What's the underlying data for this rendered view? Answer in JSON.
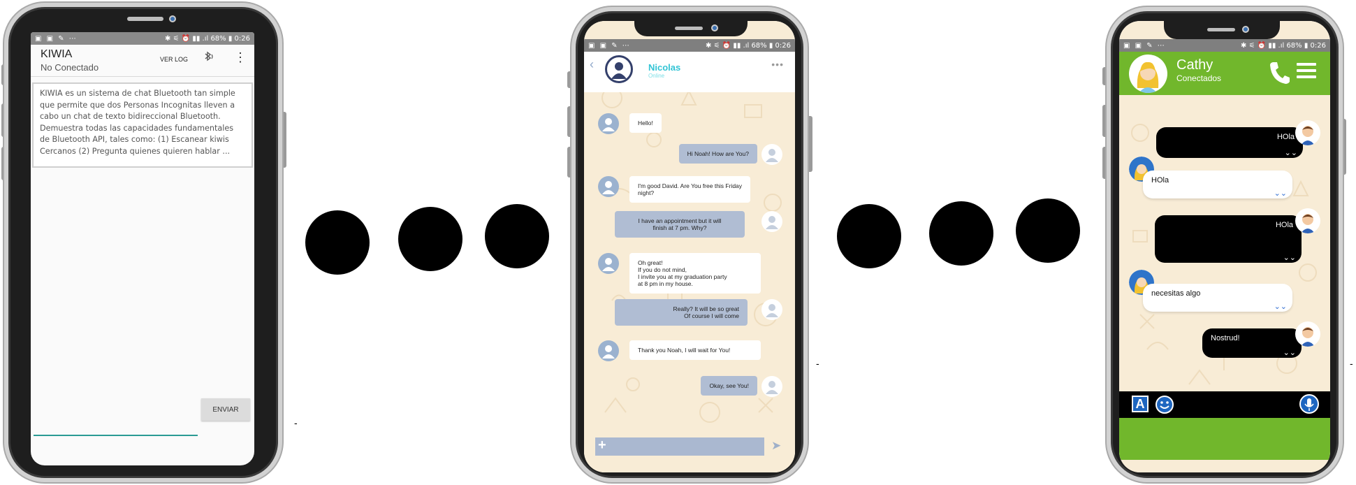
{
  "phone1": {
    "status_bar": {
      "left_icons": "▣ ▣ ✎ ⋯",
      "right": "✱ ⚟ ⏰ ▮▮ .ıl 68% ▮ 0:26"
    },
    "app_title": "KIWIA",
    "connection_status": "No Conectado",
    "ver_log": "VER LOG",
    "description": "KIWIA es un sistema de chat Bluetooth tan simple que permite que dos Personas Incognitas lleven a cabo un chat de texto bidireccional Bluetooth. Demuestra todas las capacidades fundamentales de Bluetooth API, tales como: (1) Escanear kiwis Cercanos (2) Pregunta quienes quieren hablar ...",
    "send_label": "ENVIAR",
    "input_value": ""
  },
  "phone2": {
    "status_bar": {
      "left_icons": "▣ ▣ ✎ ⋯",
      "right": "✱ ⚟ ⏰ ▮▮ .ıl 68% ▮ 0:26"
    },
    "contact_name": "Nicolas",
    "contact_status": "Online",
    "messages": [
      {
        "dir": "in",
        "text": "Hello!"
      },
      {
        "dir": "out",
        "text": "Hi Noah! How are You?"
      },
      {
        "dir": "in",
        "text": "I'm good David. Are You free this Friday\nnight?"
      },
      {
        "dir": "out",
        "text": "I have an appointment but it will\nfinish at 7 pm. Why?"
      },
      {
        "dir": "in",
        "text": "Oh great!\nIf you do not mind,\nI invite you at my graduation party\nat 8 pm in my house."
      },
      {
        "dir": "out",
        "text": "Really? It will be so great\nOf course I will come"
      },
      {
        "dir": "in",
        "text": "Thank you Noah, I will wait for You!"
      },
      {
        "dir": "out",
        "text": "Okay, see You!"
      }
    ],
    "composer_value": ""
  },
  "phone3": {
    "status_bar": {
      "left_icons": "▣ ▣ ✎ ⋯",
      "right": "✱ ⚟ ⏰ ▮▮ .ıl 68% ▮ 0:26"
    },
    "contact_name": "Cathy",
    "contact_status": "Conectados",
    "messages": [
      {
        "side": "sent",
        "text": "HOla"
      },
      {
        "side": "received",
        "text": "HOla"
      },
      {
        "side": "sent",
        "text": "HOla"
      },
      {
        "side": "received",
        "text": "necesitas algo"
      },
      {
        "side": "sent",
        "text": "Nostrud!"
      }
    ],
    "keyboard_letter": "A"
  },
  "separators": {
    "dash": "-"
  },
  "colors": {
    "kiwia_accent": "#2a9a94",
    "nicolas_name": "#32c4d5",
    "outgoing_bubble": "#b0bdd3",
    "chat_background": "#f8ecd6",
    "cathy_green": "#71b72c",
    "toolbar_blue": "#1e66c0"
  }
}
